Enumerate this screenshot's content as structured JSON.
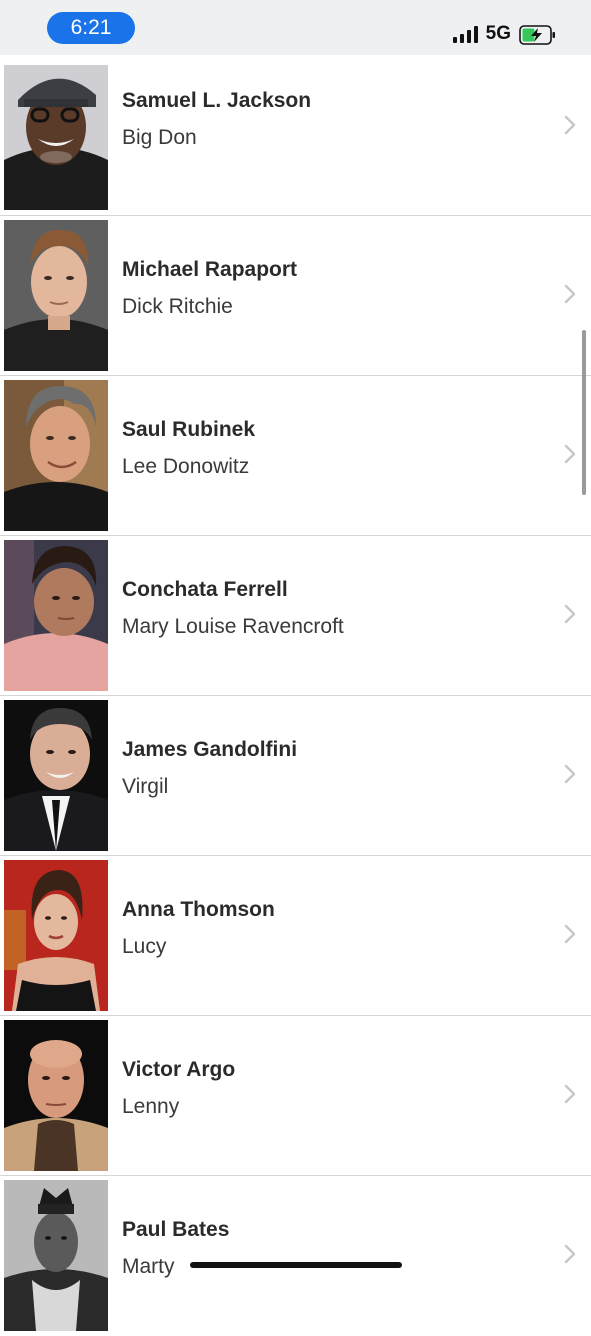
{
  "status_bar": {
    "time": "6:21",
    "network": "5G",
    "signal_icon": "cellular-signal-icon",
    "battery_icon": "battery-charging-icon"
  },
  "cast": [
    {
      "name": "Samuel L. Jackson",
      "role": "Big Don"
    },
    {
      "name": "Michael Rapaport",
      "role": "Dick Ritchie"
    },
    {
      "name": "Saul Rubinek",
      "role": "Lee Donowitz"
    },
    {
      "name": "Conchata Ferrell",
      "role": "Mary Louise Ravencroft"
    },
    {
      "name": "James Gandolfini",
      "role": "Virgil"
    },
    {
      "name": "Anna Thomson",
      "role": "Lucy"
    },
    {
      "name": "Victor Argo",
      "role": "Lenny"
    },
    {
      "name": "Paul Bates",
      "role": "Marty"
    }
  ],
  "colors": {
    "time_pill": "#1a73e8",
    "status_bg": "#eff0f2",
    "divider": "#d5d5d5",
    "chevron": "#c7c7cc"
  }
}
